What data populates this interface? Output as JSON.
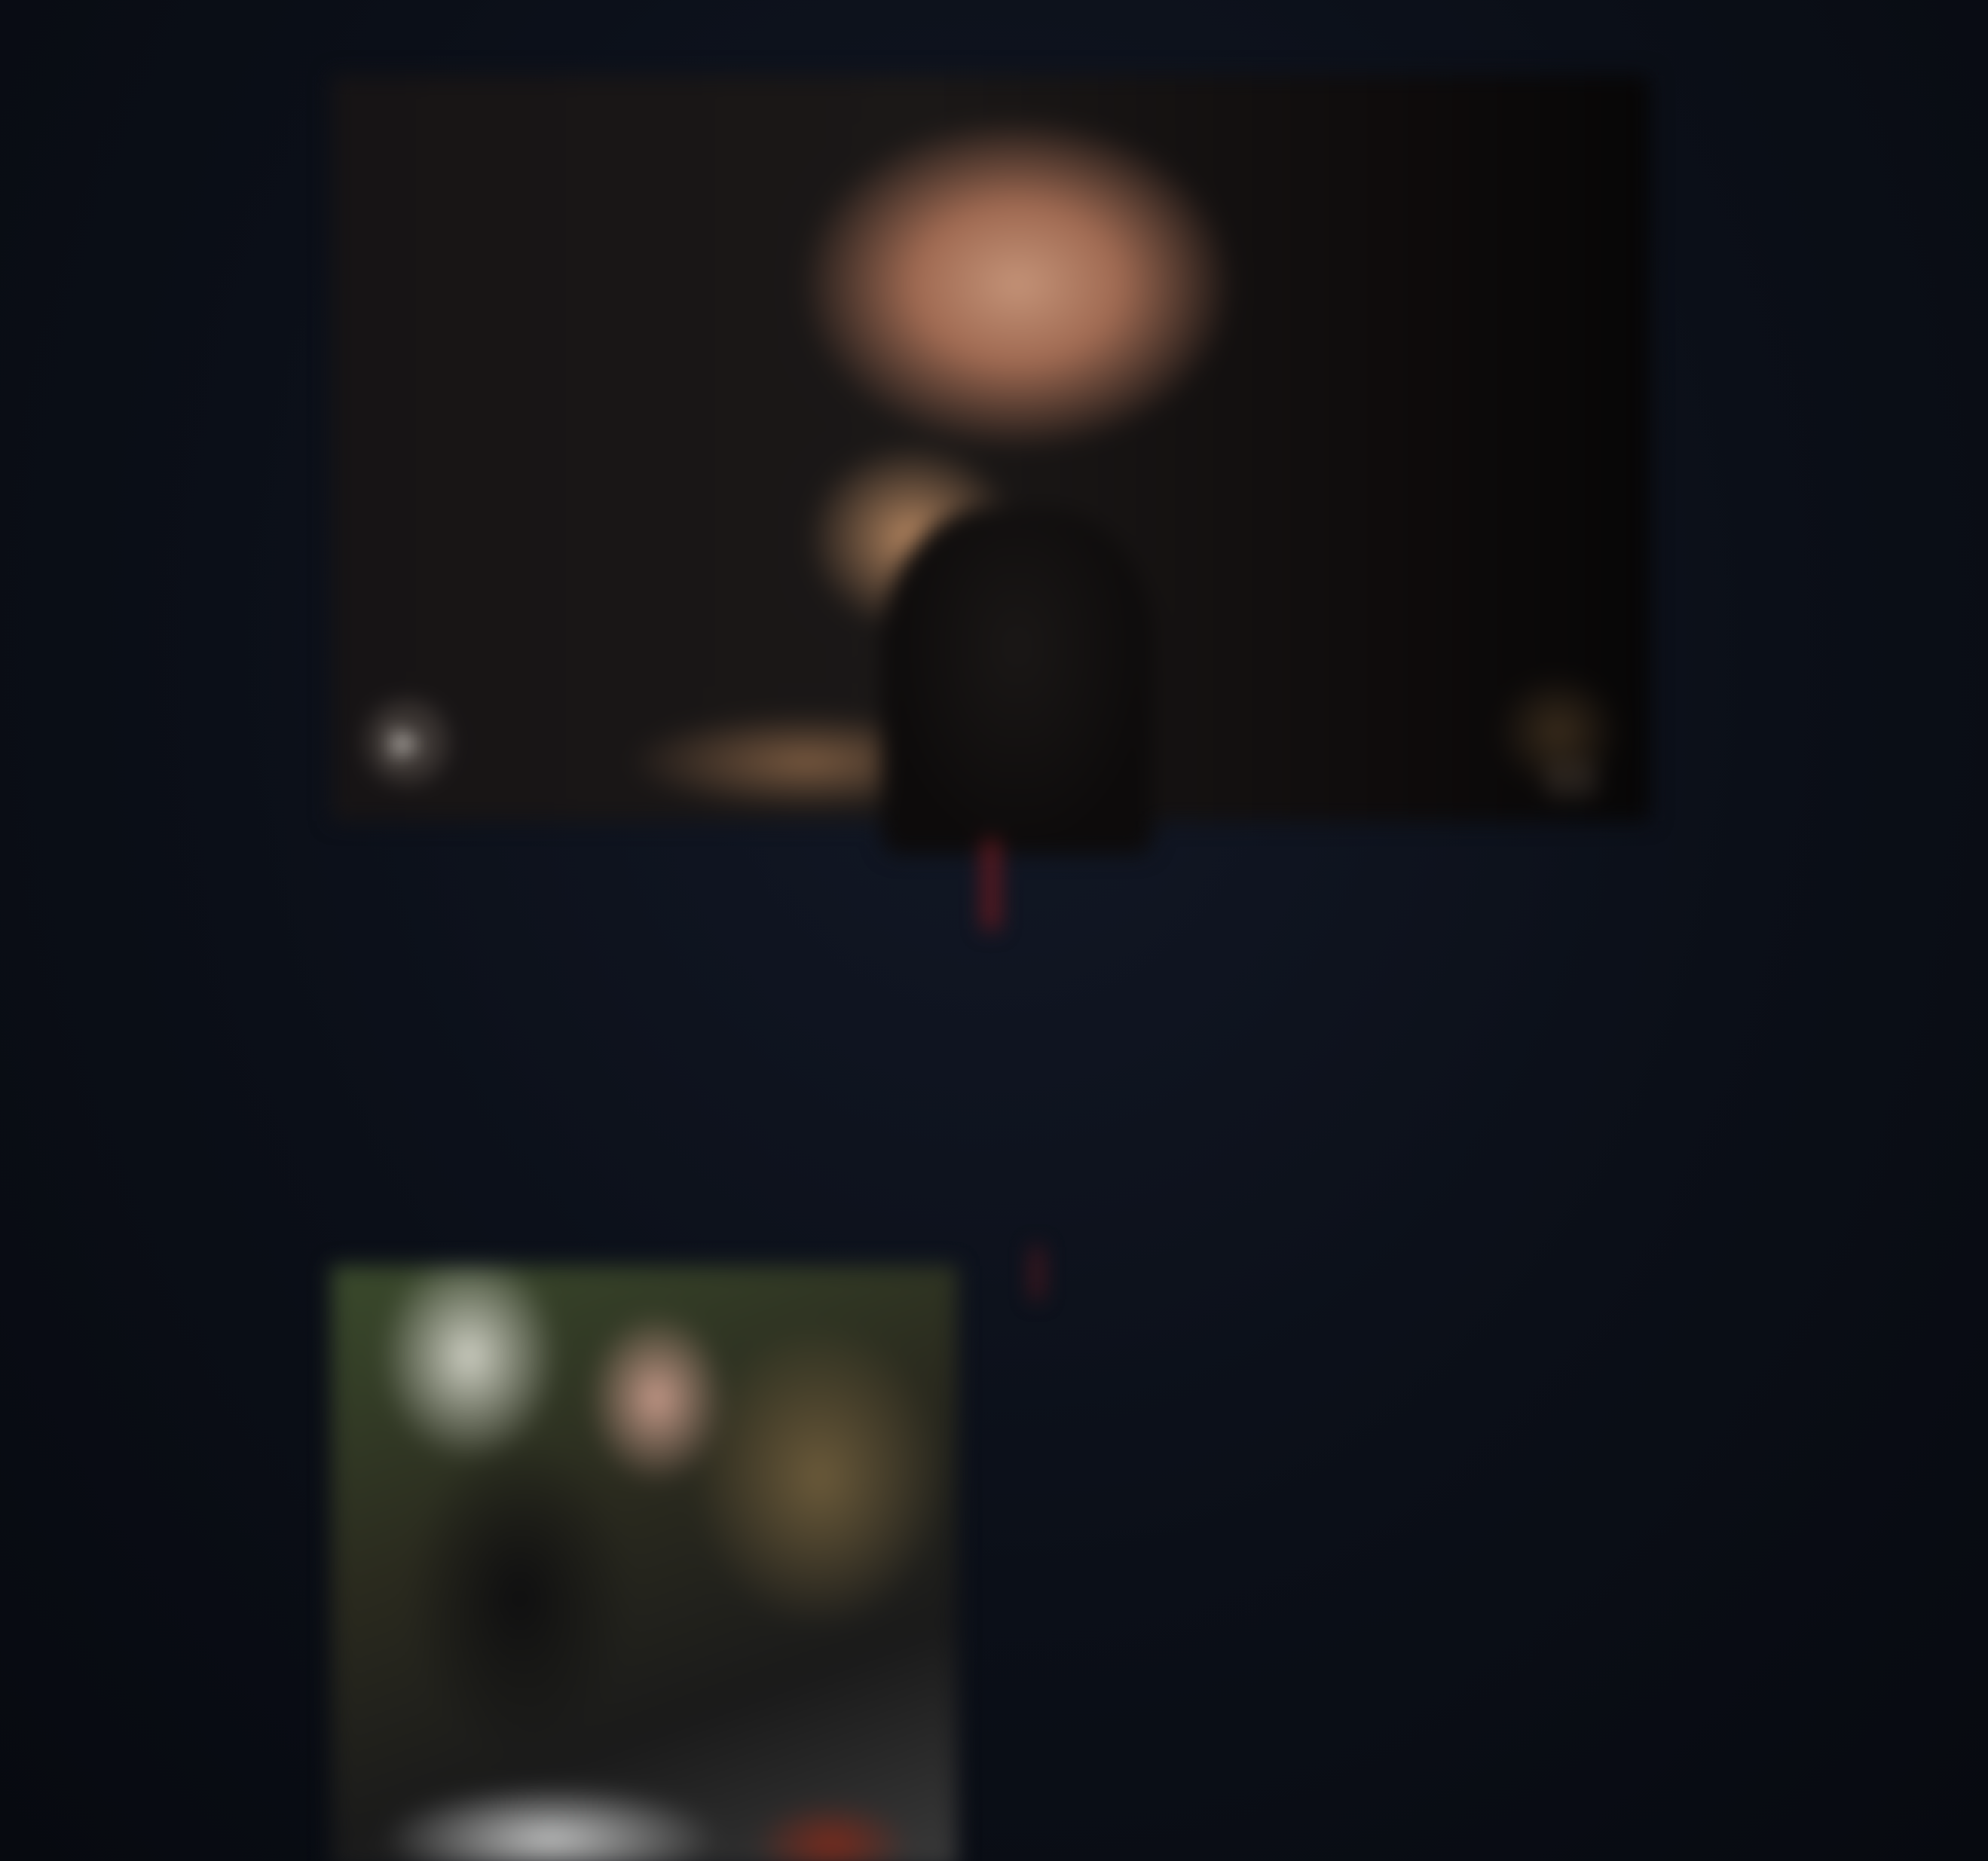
{
  "hero": {
    "play_icon": "play-icon",
    "volume_icon": "volume-icon"
  },
  "headline": {
    "part1": "",
    "accent": "",
    "part2": ""
  },
  "intro": {
    "text": ""
  },
  "related": {
    "title": "",
    "title_accent": "",
    "items": [
      "",
      "",
      "",
      "",
      ""
    ]
  },
  "colors": {
    "background": "#0b0f18",
    "accent": "#6b1a20"
  }
}
